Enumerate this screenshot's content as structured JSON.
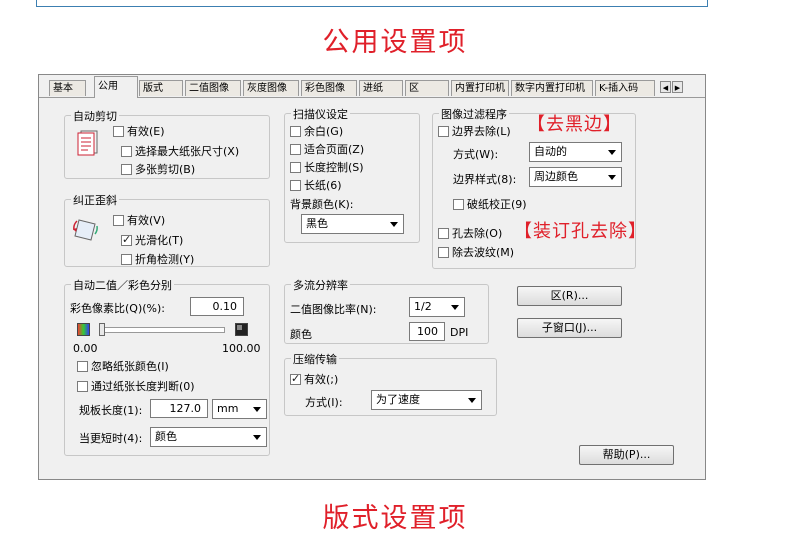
{
  "header": {
    "title": "公用设置项"
  },
  "footer": {
    "title": "版式设置项"
  },
  "tabs": [
    "基本",
    "公用",
    "版式",
    "二值图像",
    "灰度图像",
    "彩色图像",
    "进纸",
    "区",
    "内置打印机",
    "数字内置打印机",
    "K-插入码"
  ],
  "tab_scroll": {
    "left": "◀",
    "right": "▶"
  },
  "active_tab": "公用",
  "auto_crop": {
    "title": "自动剪切",
    "enabled": {
      "label": "有效(E)",
      "checked": false
    },
    "max_size": {
      "label": "选择最大纸张尺寸(X)",
      "checked": false
    },
    "multi": {
      "label": "多张剪切(B)",
      "checked": false
    }
  },
  "deskew": {
    "title": "纠正歪斜",
    "enabled": {
      "label": "有效(V)",
      "checked": false
    },
    "smooth": {
      "label": "光滑化(T)",
      "checked": true
    },
    "fold": {
      "label": "折角检测(Y)",
      "checked": false
    }
  },
  "scanner": {
    "title": "扫描仪设定",
    "margin": {
      "label": "余白(G)",
      "checked": false
    },
    "fit_page": {
      "label": "适合页面(Z)",
      "checked": false
    },
    "length_ctrl": {
      "label": "长度控制(S)",
      "checked": false
    },
    "long_paper": {
      "label": "长纸(6)",
      "checked": false
    },
    "bg_label": "背景颜色(K):",
    "bg_value": "黑色"
  },
  "filter": {
    "title": "图像过滤程序",
    "edge_remove": {
      "label": "边界去除(L)",
      "checked": false
    },
    "method_label": "方式(W):",
    "method_value": "自动的",
    "style_label": "边界样式(8):",
    "style_value": "周边颜色",
    "torn": {
      "label": "破纸校正(9)",
      "checked": false
    },
    "hole": {
      "label": "孔去除(O)",
      "checked": false
    },
    "moire": {
      "label": "除去波纹(M)",
      "checked": false
    }
  },
  "annotations": {
    "black_edge": "【去黑边】",
    "hole_remove": "【装订孔去除】"
  },
  "auto_binary": {
    "title": "自动二值／彩色分别",
    "ratio_label": "彩色像素比(Q)(%):",
    "ratio_value": "0.10",
    "scale_min": "0.00",
    "scale_max": "100.00",
    "slider_fraction": 0.0,
    "ignore_color": {
      "label": "忽略纸张颜色(I)",
      "checked": false
    },
    "by_length": {
      "label": "通过纸张长度判断(0)",
      "checked": false
    },
    "length_label": "规板长度(1):",
    "length_value": "127.0",
    "length_unit": "mm",
    "short_label": "当更短时(4):",
    "short_value": "颜色"
  },
  "multi_res": {
    "title": "多流分辨率",
    "ratio_label": "二值图像比率(N):",
    "ratio_value": "1/2",
    "color_label": "颜色",
    "color_value": "100",
    "color_unit": "DPI"
  },
  "compression": {
    "title": "压缩传输",
    "enabled": {
      "label": "有效(;)",
      "checked": true
    },
    "method_label": "方式(I):",
    "method_value": "为了速度"
  },
  "buttons": {
    "zone": "区(R)...",
    "subwindow": "子窗口(J)...",
    "help": "帮助(P)..."
  },
  "colors": {
    "accent_red": "#e0202a"
  }
}
